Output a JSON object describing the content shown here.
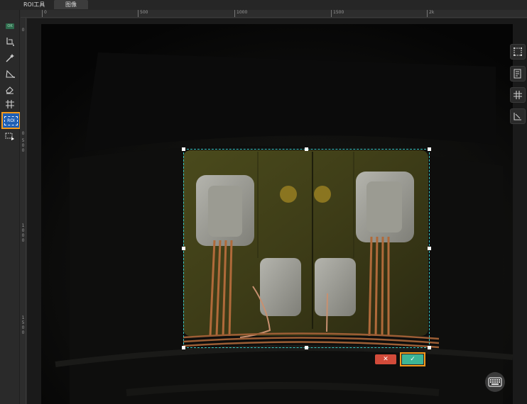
{
  "tabs": [
    {
      "label": "ROI工具"
    },
    {
      "label": "图像"
    }
  ],
  "left_toolbar": {
    "status_badge": "OK",
    "tools": [
      {
        "icon": "crop-polygon-icon"
      },
      {
        "icon": "magic-wand-icon"
      },
      {
        "icon": "angle-measure-icon"
      },
      {
        "icon": "eraser-icon"
      },
      {
        "icon": "grid-icon"
      },
      {
        "icon": "roi-icon",
        "label": "ROI",
        "active": true
      },
      {
        "icon": "roi-play-icon"
      }
    ]
  },
  "ruler_top": [
    "0",
    "500",
    "1000",
    "1500",
    "2k"
  ],
  "ruler_left": [
    "0",
    "0",
    "500",
    "1000",
    "1500"
  ],
  "roi_actions": {
    "cancel_label": "✕",
    "confirm_label": "✓"
  },
  "right_toolbar": [
    {
      "icon": "polygon-select-icon"
    },
    {
      "icon": "document-edit-icon"
    },
    {
      "icon": "grid-lines-icon"
    },
    {
      "icon": "measure-area-icon"
    }
  ],
  "colors": {
    "accent": "#f39a1d",
    "active_tool": "#1f5fb4",
    "roi_outline": "#39c7c2",
    "cancel": "#d24b3a",
    "confirm": "#3db596"
  }
}
